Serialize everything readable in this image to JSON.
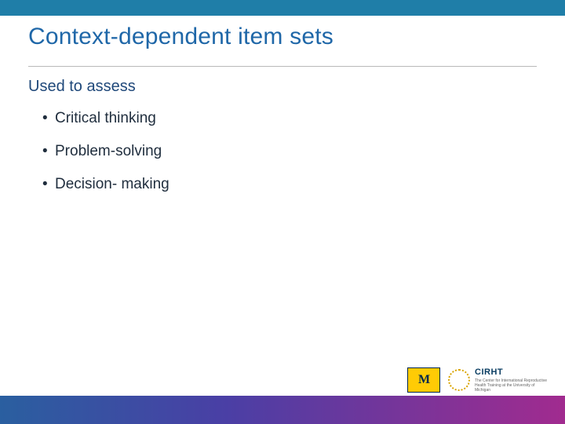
{
  "title": "Context-dependent item sets",
  "subhead": "Used to assess",
  "bullets": [
    "Critical thinking",
    "Problem-solving",
    "Decision- making"
  ],
  "logos": {
    "um_letter": "M",
    "cirht_name": "CIRHT",
    "cirht_sub": "The Center for International Reproductive Health Training at the University of Michigan"
  }
}
